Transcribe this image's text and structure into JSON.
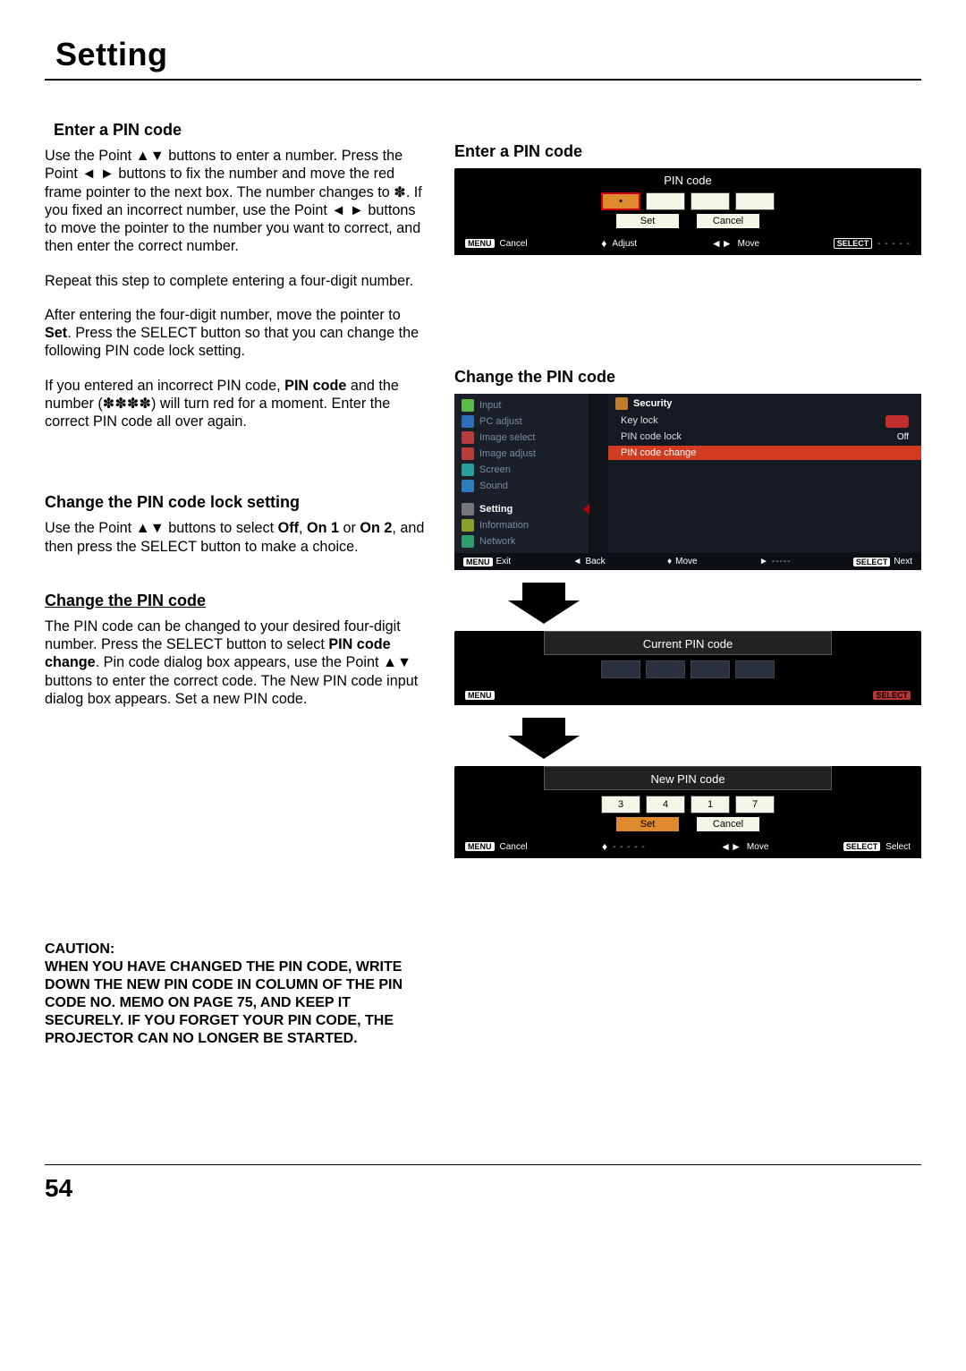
{
  "header": {
    "title": "Setting"
  },
  "page_number": "54",
  "left": {
    "enter_pin": {
      "title": "Enter a PIN code",
      "p1_a": "Use the Point ▲▼ buttons to enter a number. Press the Point ◄ ► buttons to fix the number and move the red frame pointer to the next box. The number changes to ",
      "p1_star": "✽",
      "p1_b": ". If you fixed an incorrect number, use the Point ◄ ► buttons to move the pointer to the number you want to correct, and then enter the correct number.",
      "p2": "Repeat this step to complete entering a four-digit number.",
      "p3_a": "After entering the four-digit number, move the pointer to ",
      "p3_set": "Set",
      "p3_b": ". Press the SELECT button so that you can change the following PIN code lock setting.",
      "p4_a": "If you entered an incorrect PIN code, ",
      "p4_bold": "PIN code",
      "p4_b": " and the number (✽✽✽✽) will turn red for a moment. Enter the correct PIN code all over again."
    },
    "change_lock": {
      "title": "Change the PIN code lock setting",
      "p1_a": "Use the Point ▲▼ buttons to select ",
      "off": "Off",
      "on1": "On 1",
      "on2": "On 2",
      "p1_b": ", and then press the SELECT button to make a choice."
    },
    "change_pin": {
      "title": "Change the PIN code",
      "p1_a": "The PIN code can be changed to your desired four-digit number. Press the SELECT button to select ",
      "bold": "PIN code change",
      "p1_b": ". Pin code dialog box appears, use the Point ▲▼ buttons to enter the correct code. The New PIN code input dialog box appears. Set a new PIN code."
    },
    "caution": {
      "label": "CAUTION:",
      "text": "WHEN YOU HAVE CHANGED THE PIN CODE, WRITE DOWN THE NEW PIN CODE IN COLUMN OF THE PIN CODE NO. MEMO ON PAGE 75, AND KEEP IT SECURELY. IF YOU FORGET YOUR PIN CODE, THE PROJECTOR CAN NO LONGER BE STARTED."
    }
  },
  "right": {
    "enter_pin": {
      "title": "Enter a PIN code",
      "osd_title": "PIN code",
      "box1": "•",
      "set": "Set",
      "cancel": "Cancel",
      "f_menu": "MENU",
      "f_cancel": "Cancel",
      "f_adjust": "Adjust",
      "f_move": "Move",
      "f_select": "SELECT",
      "f_dashes": "- - - - -"
    },
    "change_pin": {
      "title": "Change the PIN code",
      "menu": {
        "items": [
          "Input",
          "PC adjust",
          "Image select",
          "Image adjust",
          "Screen",
          "Sound",
          "Setting",
          "Information",
          "Network"
        ],
        "selected_index": 6,
        "right_header": "Security",
        "rows": [
          {
            "label": "Key lock",
            "status_icon": "red"
          },
          {
            "label": "PIN code lock",
            "status_text": "Off"
          },
          {
            "label": "PIN code change",
            "selected": true
          }
        ],
        "footer": {
          "menu": "MENU",
          "exit": "Exit",
          "back": "Back",
          "move": "Move",
          "dashes": "-----",
          "select": "SELECT",
          "next": "Next"
        }
      },
      "current": {
        "title": "Current PIN code",
        "f_menu": "MENU",
        "f_select": "SELECT"
      },
      "newpin": {
        "title": "New PIN code",
        "d1": "3",
        "d2": "4",
        "d3": "1",
        "d4": "7",
        "set": "Set",
        "cancel": "Cancel",
        "f_menu": "MENU",
        "f_cancel": "Cancel",
        "f_dashes": "- - - - -",
        "f_move": "Move",
        "f_select_badge": "SELECT",
        "f_select": "Select"
      }
    }
  }
}
